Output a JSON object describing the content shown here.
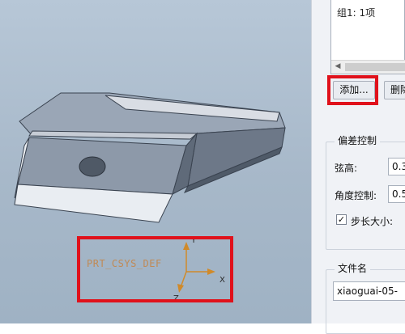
{
  "viewport": {
    "background_top": "#b7c7d7",
    "background_bottom": "#9fb2c4",
    "csys_label": "PRT_CSYS_DEF",
    "axis_y": "Y",
    "axis_x": "X",
    "axis_z": "Z",
    "highlight_color": "#e0111b",
    "csys_color": "#c08a55"
  },
  "panel": {
    "list": {
      "items": [
        "组1: 1项"
      ]
    },
    "add_button": "添加...",
    "delete_button": "删除",
    "tolerance": {
      "title": "偏差控制",
      "chord_label": "弦高:",
      "chord_value": "0.3",
      "angle_label": "角度控制:",
      "angle_value": "0.5",
      "step_label": "步长大小:",
      "step_checked": true
    },
    "file": {
      "title": "文件名",
      "filename": "xiaoguai-05-"
    }
  }
}
